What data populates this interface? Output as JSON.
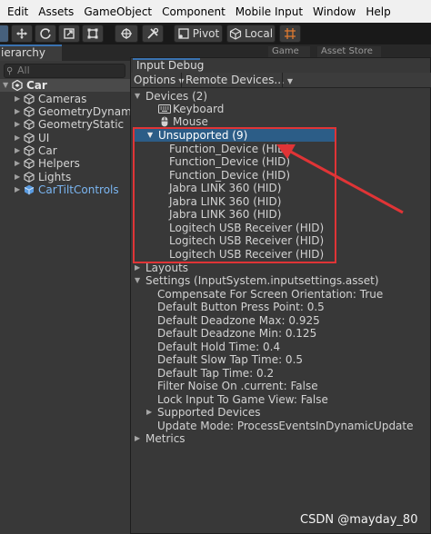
{
  "menu": {
    "items": [
      "Edit",
      "Assets",
      "GameObject",
      "Component",
      "Mobile Input",
      "Window",
      "Help"
    ]
  },
  "toolbar": {
    "pivot_label": "Pivot",
    "local_label": "Local"
  },
  "hierarchy": {
    "tab_label": "ierarchy",
    "search_placeholder": "All",
    "root": "Car",
    "children": [
      "Cameras",
      "GeometryDynamic",
      "GeometryStatic",
      "UI",
      "Car",
      "Helpers",
      "Lights",
      "CarTiltControls"
    ]
  },
  "scene_tabs": [
    "Game",
    "Asset Store"
  ],
  "input_debug": {
    "tab_label": "Input Debug",
    "options_label": "Options",
    "remote_label": "Remote Devices...",
    "devices_label": "Devices (2)",
    "keyboard_label": "Keyboard",
    "mouse_label": "Mouse",
    "unsupported_label": "Unsupported (9)",
    "unsupported_items": [
      "Function_Device (HID)",
      "Function_Device (HID)",
      "Function_Device (HID)",
      "Jabra LINK 360 (HID)",
      "Jabra LINK 360 (HID)",
      "Jabra LINK 360 (HID)",
      "Logitech USB Receiver (HID)",
      "Logitech USB Receiver (HID)",
      "Logitech USB Receiver (HID)"
    ],
    "layouts_label": "Layouts",
    "settings_label": "Settings (InputSystem.inputsettings.asset)",
    "settings_items": [
      "Compensate For Screen Orientation: True",
      "Default Button Press Point: 0.5",
      "Default Deadzone Max: 0.925",
      "Default Deadzone Min: 0.125",
      "Default Hold Time: 0.4",
      "Default Slow Tap Time: 0.5",
      "Default Tap Time: 0.2",
      "Filter Noise On .current: False",
      "Lock Input To Game View: False"
    ],
    "supported_devices_label": "Supported Devices",
    "update_mode_label": "Update Mode: ProcessEventsInDynamicUpdate",
    "metrics_label": "Metrics"
  },
  "watermark": "CSDN @mayday_80",
  "colors": {
    "selection": "#2c5d87",
    "annotation_red": "#e03436",
    "accent_blue": "#3a72b0"
  }
}
